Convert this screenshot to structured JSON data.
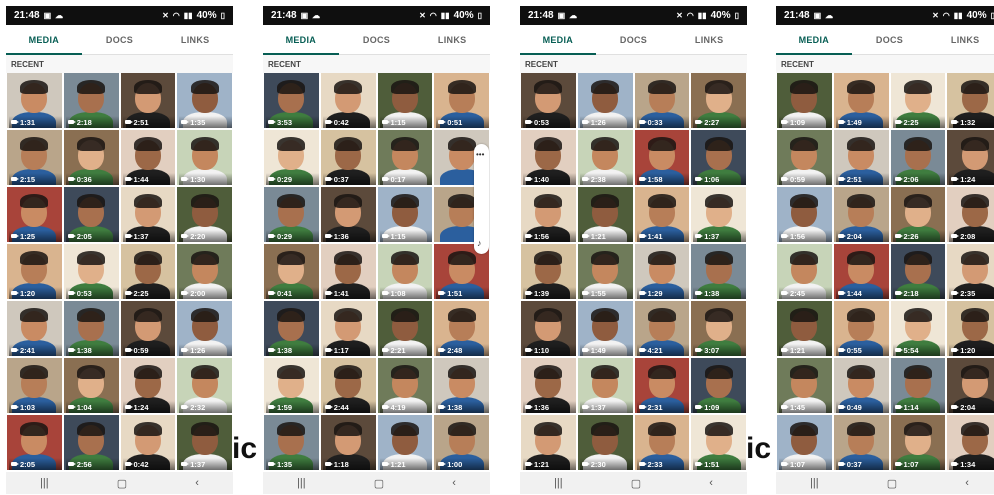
{
  "screens": [
    {
      "status": {
        "time": "21:48",
        "battery": "40%"
      },
      "tabs": [
        "MEDIA",
        "DOCS",
        "LINKS"
      ],
      "section": "RECENT",
      "durations": [
        "1:31",
        "2:18",
        "2:51",
        "1:35",
        "2:15",
        "0:36",
        "1:44",
        "1:30",
        "1:25",
        "2:05",
        "1:37",
        "2:20",
        "1:20",
        "0:53",
        "2:25",
        "2:00",
        "2:41",
        "1:38",
        "0:59",
        "1:26",
        "1:03",
        "1:04",
        "1:24",
        "2:32",
        "2:05",
        "2:56",
        "0:42",
        "1:37"
      ]
    },
    {
      "status": {
        "time": "21:48",
        "battery": "40%"
      },
      "tabs": [
        "MEDIA",
        "DOCS",
        "LINKS"
      ],
      "section": "RECENT",
      "durations": [
        "3:53",
        "0:42",
        "1:15",
        "0:51",
        "0:29",
        "0:37",
        "0:17",
        "",
        "0:29",
        "1:36",
        "1:15",
        "",
        "0:41",
        "1:41",
        "1:08",
        "1:51",
        "1:38",
        "1:17",
        "2:21",
        "2:48",
        "1:59",
        "2:44",
        "4:19",
        "1:38",
        "1:35",
        "1:18",
        "1:21",
        "1:00"
      ]
    },
    {
      "status": {
        "time": "21:48",
        "battery": "40%"
      },
      "tabs": [
        "MEDIA",
        "DOCS",
        "LINKS"
      ],
      "section": "RECENT",
      "durations": [
        "0:53",
        "1:26",
        "0:33",
        "2:27",
        "1:40",
        "2:38",
        "1:58",
        "1:06",
        "1:56",
        "1:21",
        "1:41",
        "1:37",
        "1:39",
        "1:55",
        "1:29",
        "1:38",
        "1:10",
        "1:49",
        "4:21",
        "3:07",
        "1:36",
        "1:37",
        "2:31",
        "1:09",
        "1:21",
        "2:30",
        "2:33",
        "1:51"
      ]
    },
    {
      "status": {
        "time": "21:48",
        "battery": "40%"
      },
      "tabs": [
        "MEDIA",
        "DOCS",
        "LINKS"
      ],
      "section": "RECENT",
      "durations": [
        "1:09",
        "1:49",
        "2:25",
        "1:32",
        "0:59",
        "2:51",
        "2:06",
        "1:24",
        "1:56",
        "2:04",
        "2:26",
        "2:08",
        "2:45",
        "1:44",
        "2:18",
        "2:35",
        "1:21",
        "0:55",
        "5:54",
        "1:20",
        "1:45",
        "0:49",
        "1:14",
        "2:04",
        "1:07",
        "0:37",
        "1:07",
        "1:34"
      ]
    }
  ],
  "overlay_text": [
    "ic",
    "ic"
  ],
  "nav_icons": [
    "recents-icon",
    "home-icon",
    "back-icon"
  ],
  "colors": {
    "accent": "#075e54",
    "statusbar": "#0f0f0f"
  }
}
